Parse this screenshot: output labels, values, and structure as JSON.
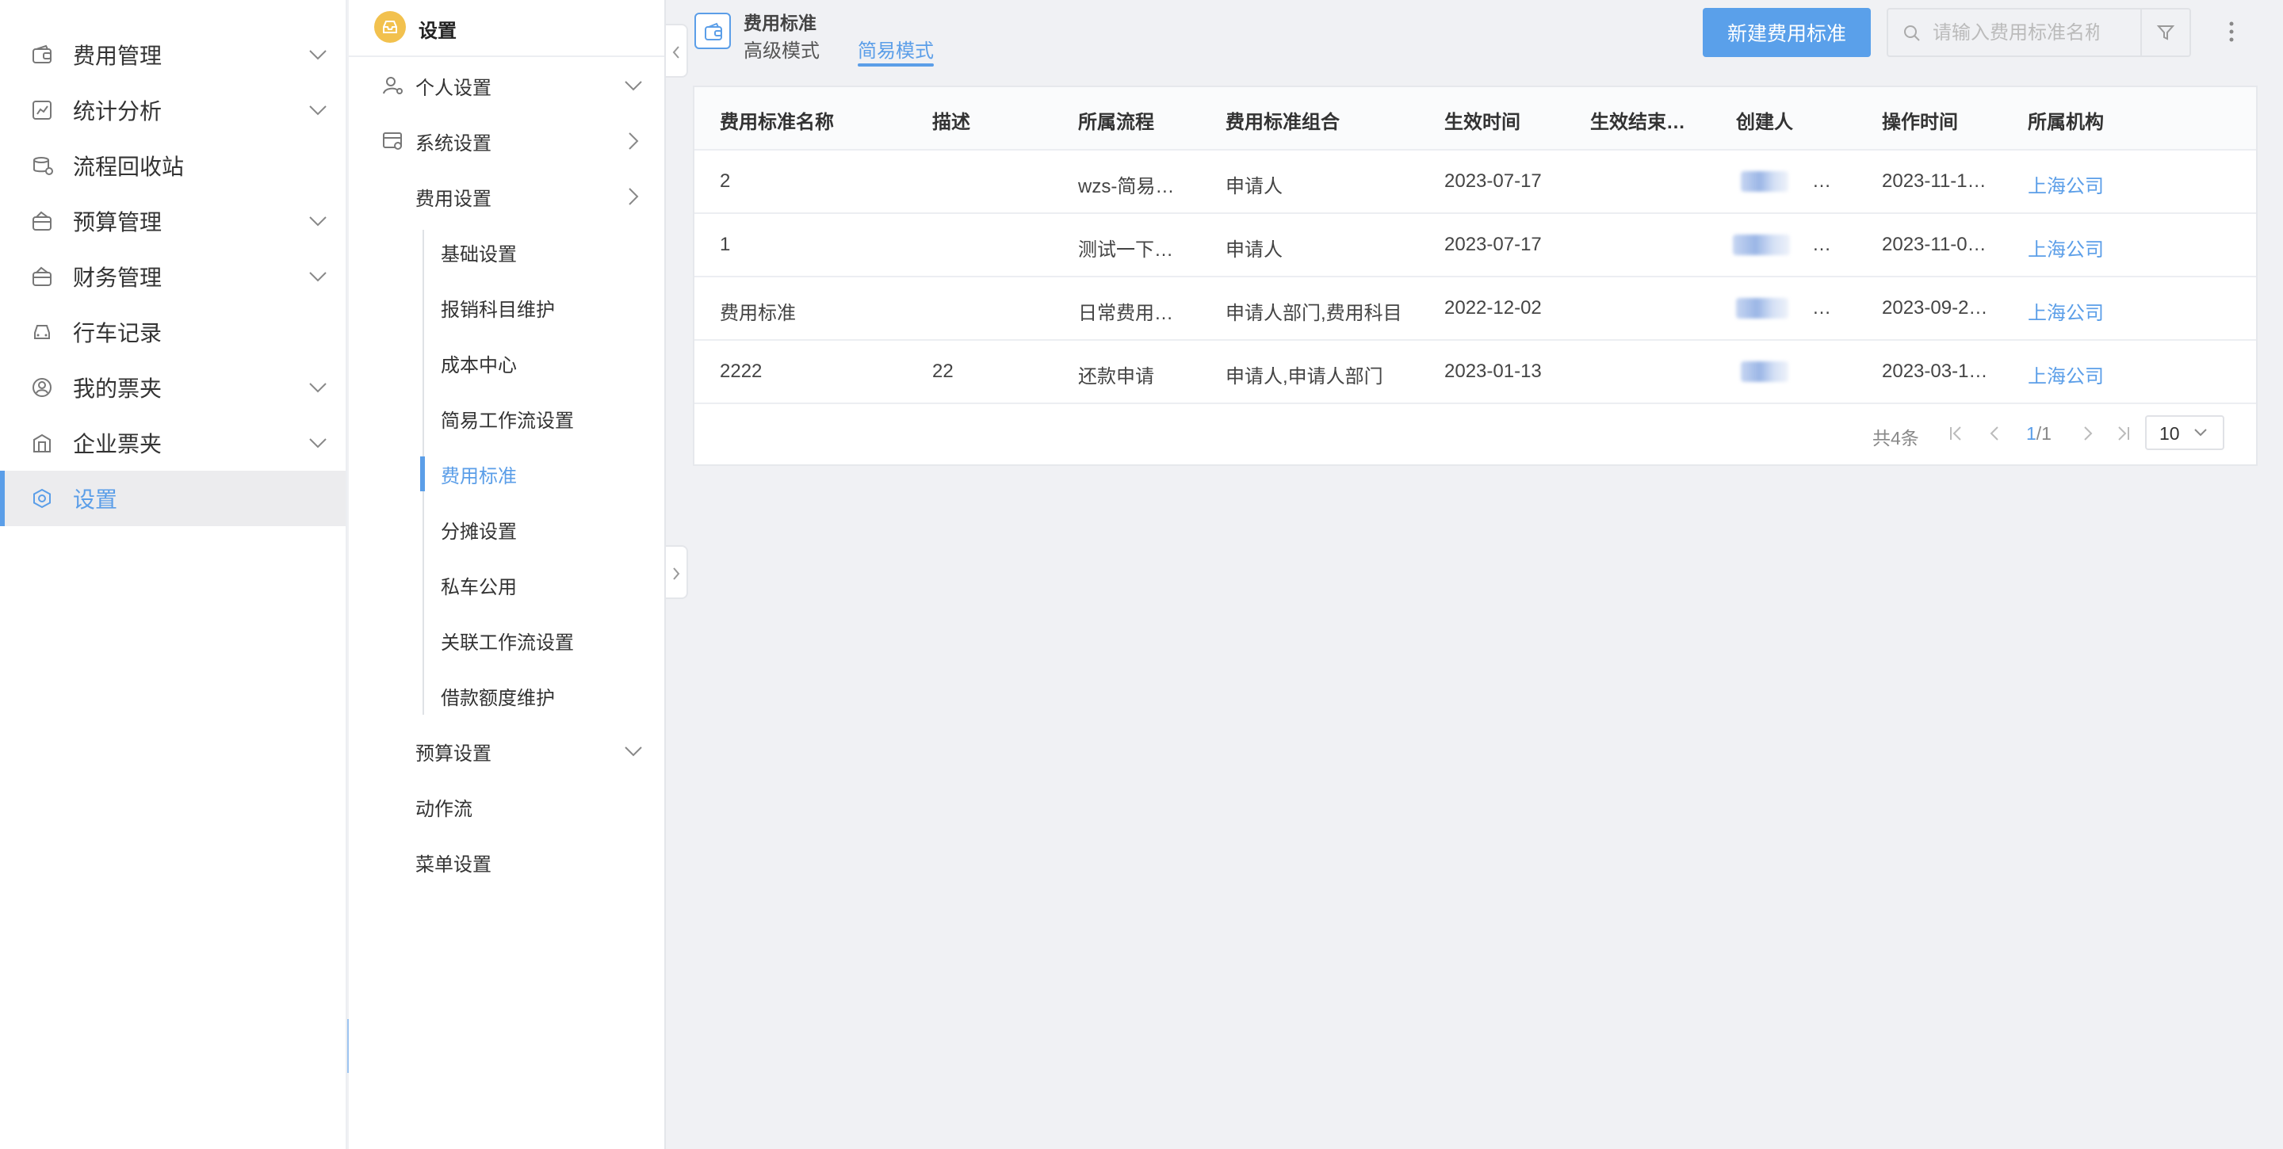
{
  "leftnav": {
    "items": [
      {
        "label": "费用管理",
        "icon": "wallet-icon",
        "expandable": true
      },
      {
        "label": "统计分析",
        "icon": "chart-icon",
        "expandable": true
      },
      {
        "label": "流程回收站",
        "icon": "recycle-bin-icon",
        "expandable": false
      },
      {
        "label": "预算管理",
        "icon": "budget-icon",
        "expandable": true
      },
      {
        "label": "财务管理",
        "icon": "finance-icon",
        "expandable": true
      },
      {
        "label": "行车记录",
        "icon": "car-icon",
        "expandable": false
      },
      {
        "label": "我的票夹",
        "icon": "user-circle-icon",
        "expandable": true
      },
      {
        "label": "企业票夹",
        "icon": "building-icon",
        "expandable": true
      },
      {
        "label": "设置",
        "icon": "settings-icon",
        "expandable": false,
        "active": true
      }
    ]
  },
  "subpanel": {
    "title": "设置",
    "items": {
      "personal": "个人设置",
      "system": "系统设置",
      "expense": "费用设置",
      "budget": "预算设置",
      "actionflow": "动作流",
      "menu": "菜单设置"
    },
    "leaves": [
      "基础设置",
      "报销科目维护",
      "成本中心",
      "简易工作流设置",
      "费用标准",
      "分摊设置",
      "私车公用",
      "关联工作流设置",
      "借款额度维护"
    ]
  },
  "main": {
    "title": "费用标准",
    "tabs": [
      "高级模式",
      "简易模式"
    ],
    "new_button": "新建费用标准",
    "search_placeholder": "请输入费用标准名称"
  },
  "table": {
    "headers": [
      "费用标准名称",
      "描述",
      "所属流程",
      "费用标准组合",
      "生效时间",
      "生效结束…",
      "创建人",
      "操作时间",
      "所属机构"
    ],
    "rows": [
      {
        "name": "2",
        "desc": "",
        "flow": "wzs-简易…",
        "combo": "申请人",
        "start": "2023-07-17",
        "end": "",
        "creator_suffix": "…",
        "optime": "2023-11-1…",
        "org": "上海公司"
      },
      {
        "name": "1",
        "desc": "",
        "flow": "测试一下…",
        "combo": "申请人",
        "start": "2023-07-17",
        "end": "",
        "creator_suffix": "…",
        "optime": "2023-11-0…",
        "org": "上海公司"
      },
      {
        "name": "费用标准",
        "desc": "",
        "flow": "日常费用…",
        "combo": "申请人部门,费用科目",
        "start": "2022-12-02",
        "end": "",
        "creator_suffix": "…",
        "optime": "2023-09-2…",
        "org": "上海公司"
      },
      {
        "name": "2222",
        "desc": "22",
        "flow": "还款申请",
        "combo": "申请人,申请人部门",
        "start": "2023-01-13",
        "end": "",
        "creator_suffix": "",
        "optime": "2023-03-1…",
        "org": "上海公司"
      }
    ]
  },
  "pager": {
    "total": "共4条",
    "current": "1",
    "pages": "/1",
    "page_size": "10"
  },
  "colors": {
    "accent": "#5b9ee8",
    "button": "#5aa0ea",
    "badge": "#f2c14e"
  }
}
